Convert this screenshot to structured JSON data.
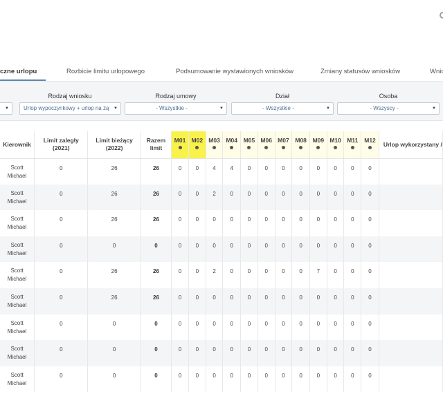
{
  "tabs": [
    {
      "label": "czne urlopu",
      "active": true
    },
    {
      "label": "Rozbicie limitu urlopowego",
      "active": false
    },
    {
      "label": "Podsumowanie wystawionych wniosków",
      "active": false
    },
    {
      "label": "Zmiany statusów wniosków",
      "active": false
    },
    {
      "label": "Wnio",
      "active": false
    }
  ],
  "filters": {
    "rodzaj_wniosku": {
      "label": "Rodzaj wniosku",
      "value": "Urlop wypoczynkowy + urlop na żą"
    },
    "rodzaj_umowy": {
      "label": "Rodzaj umowy",
      "value": "- Wszystkie -"
    },
    "dzial": {
      "label": "Dział",
      "value": "- Wszystkie -"
    },
    "osoba": {
      "label": "Osoba",
      "value": "- Wszyscy -"
    }
  },
  "table": {
    "headers": {
      "kierownik": "Kierownik",
      "limit_zalegly": "Limit zaległy (2021)",
      "limit_biezacy": "Limit bieżący (2022)",
      "razem": "Razem limit",
      "months": [
        "M01",
        "M02",
        "M03",
        "M04",
        "M05",
        "M06",
        "M07",
        "M08",
        "M09",
        "M10",
        "M11",
        "M12"
      ],
      "wykorzystany": "Urlop wykorzystany /"
    },
    "highlighted_months": [
      "M01",
      "M02"
    ],
    "highlight_color": "#f9f24a",
    "rows": [
      {
        "name1": "Scott",
        "name2": "Michael",
        "zalegly": "0",
        "biezacy": "26",
        "razem": "26",
        "m": [
          "0",
          "0",
          "4",
          "4",
          "0",
          "0",
          "0",
          "0",
          "0",
          "0",
          "0",
          "0"
        ]
      },
      {
        "name1": "Scott",
        "name2": "Michael",
        "zalegly": "0",
        "biezacy": "26",
        "razem": "26",
        "m": [
          "0",
          "0",
          "2",
          "0",
          "0",
          "0",
          "0",
          "0",
          "0",
          "0",
          "0",
          "0"
        ]
      },
      {
        "name1": "Scott",
        "name2": "Michael",
        "zalegly": "0",
        "biezacy": "26",
        "razem": "26",
        "m": [
          "0",
          "0",
          "0",
          "0",
          "0",
          "0",
          "0",
          "0",
          "0",
          "0",
          "0",
          "0"
        ]
      },
      {
        "name1": "Scott",
        "name2": "Michael",
        "zalegly": "0",
        "biezacy": "0",
        "razem": "0",
        "m": [
          "0",
          "0",
          "0",
          "0",
          "0",
          "0",
          "0",
          "0",
          "0",
          "0",
          "0",
          "0"
        ]
      },
      {
        "name1": "Scott",
        "name2": "Michael",
        "zalegly": "0",
        "biezacy": "26",
        "razem": "26",
        "m": [
          "0",
          "0",
          "2",
          "0",
          "0",
          "0",
          "0",
          "0",
          "7",
          "0",
          "0",
          "0"
        ]
      },
      {
        "name1": "Scott",
        "name2": "Michael",
        "zalegly": "0",
        "biezacy": "26",
        "razem": "26",
        "m": [
          "0",
          "0",
          "0",
          "0",
          "0",
          "0",
          "0",
          "0",
          "0",
          "0",
          "0",
          "0"
        ]
      },
      {
        "name1": "Scott",
        "name2": "Michael",
        "zalegly": "0",
        "biezacy": "0",
        "razem": "0",
        "m": [
          "0",
          "0",
          "0",
          "0",
          "0",
          "0",
          "0",
          "0",
          "0",
          "0",
          "0",
          "0"
        ]
      },
      {
        "name1": "Scott",
        "name2": "Michael",
        "zalegly": "0",
        "biezacy": "0",
        "razem": "0",
        "m": [
          "0",
          "0",
          "0",
          "0",
          "0",
          "0",
          "0",
          "0",
          "0",
          "0",
          "0",
          "0"
        ]
      },
      {
        "name1": "Scott",
        "name2": "Michael",
        "zalegly": "0",
        "biezacy": "0",
        "razem": "0",
        "m": [
          "0",
          "0",
          "0",
          "0",
          "0",
          "0",
          "0",
          "0",
          "0",
          "0",
          "0",
          "0"
        ]
      }
    ]
  }
}
